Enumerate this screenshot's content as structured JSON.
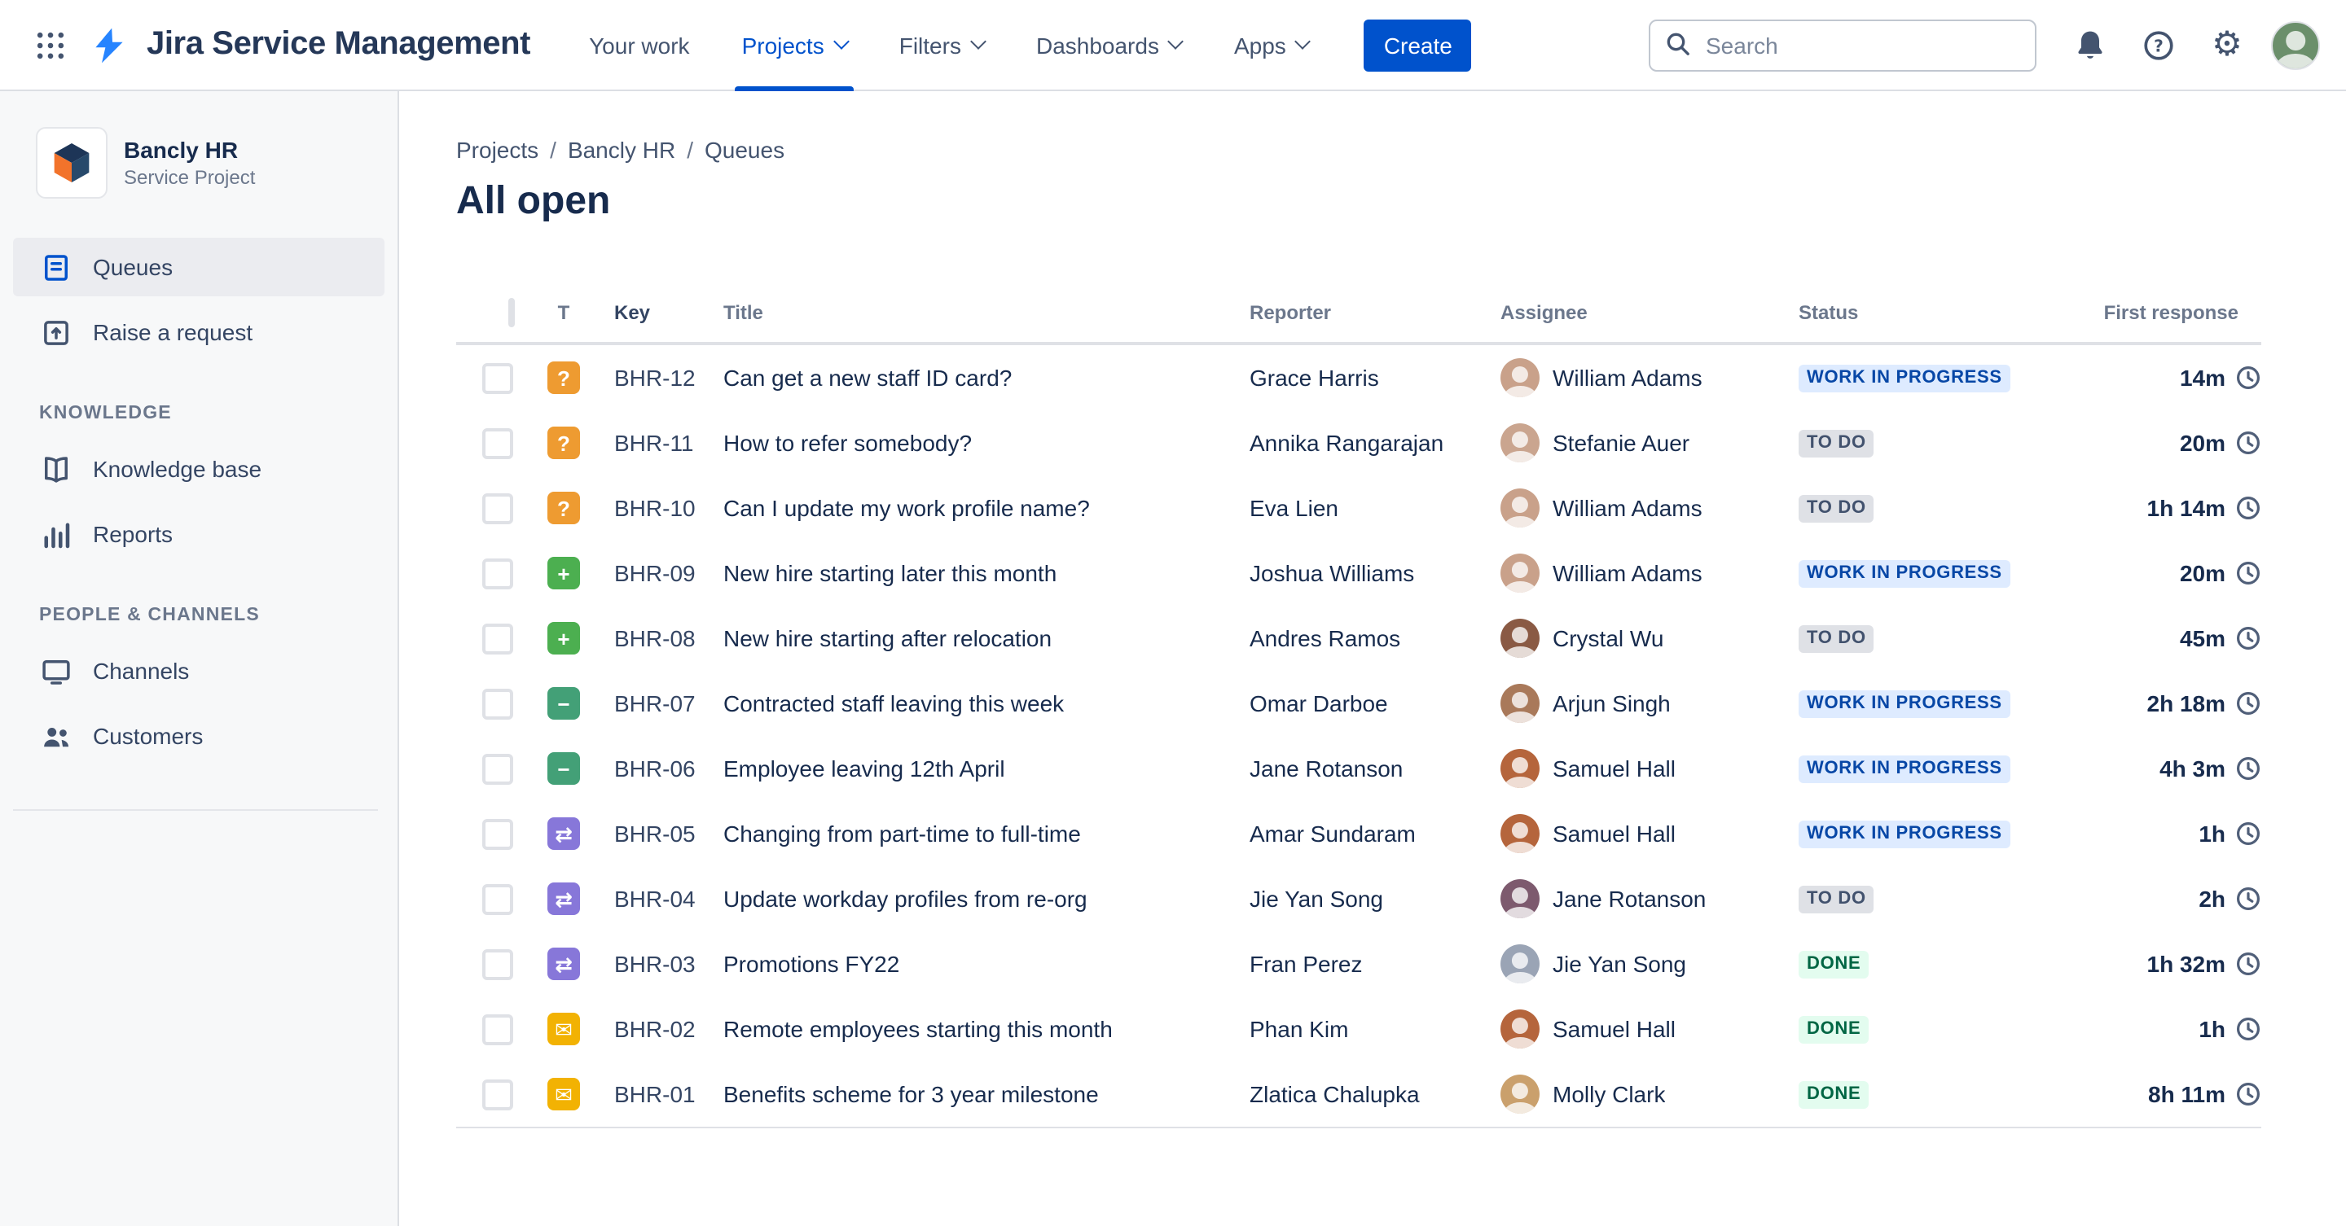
{
  "topbar": {
    "app_name": "Jira Service Management",
    "nav": [
      {
        "label": "Your work",
        "chevron": false,
        "active": false
      },
      {
        "label": "Projects",
        "chevron": true,
        "active": true
      },
      {
        "label": "Filters",
        "chevron": true,
        "active": false
      },
      {
        "label": "Dashboards",
        "chevron": true,
        "active": false
      },
      {
        "label": "Apps",
        "chevron": true,
        "active": false
      }
    ],
    "create_button": "Create",
    "search_placeholder": "Search",
    "icon_names": [
      "app-switcher-icon",
      "jira-logo",
      "notifications-icon",
      "help-icon",
      "settings-icon",
      "user-avatar"
    ],
    "accent_color": "#0052CC"
  },
  "sidebar": {
    "project_name": "Bancly HR",
    "project_subtitle": "Service Project",
    "main_items": [
      {
        "label": "Queues",
        "icon": "queues-icon",
        "active": true
      },
      {
        "label": "Raise a request",
        "icon": "raise-request-icon",
        "active": false
      }
    ],
    "sections": [
      {
        "heading": "KNOWLEDGE",
        "items": [
          {
            "label": "Knowledge base",
            "icon": "knowledge-base-icon"
          },
          {
            "label": "Reports",
            "icon": "reports-icon"
          }
        ]
      },
      {
        "heading": "PEOPLE & CHANNELS",
        "items": [
          {
            "label": "Channels",
            "icon": "channels-icon"
          },
          {
            "label": "Customers",
            "icon": "customers-icon"
          }
        ]
      }
    ]
  },
  "breadcrumb": {
    "items": [
      "Projects",
      "Bancly HR",
      "Queues"
    ],
    "separator": "/"
  },
  "page_title": "All open",
  "queue_table": {
    "columns": {
      "type": "T",
      "key": "Key",
      "title": "Title",
      "reporter": "Reporter",
      "assignee": "Assignee",
      "status": "Status",
      "first_response": "First response"
    },
    "status_colors": {
      "WORK IN PROGRESS": {
        "bg": "#DEEBFF",
        "text": "#0747A6"
      },
      "TO DO": {
        "bg": "#DFE1E6",
        "text": "#42526E"
      },
      "DONE": {
        "bg": "#E3FCEF",
        "text": "#006644"
      }
    },
    "type_icons": {
      "question": {
        "glyph": "?",
        "color": "#EE9B31"
      },
      "new-starter": {
        "glyph": "+",
        "color": "#4CAF50"
      },
      "leaver": {
        "glyph": "−",
        "color": "#43A077"
      },
      "change": {
        "glyph": "⇄",
        "color": "#8777D9"
      },
      "email": {
        "glyph": "✉",
        "color": "#F2B203"
      }
    },
    "rows": [
      {
        "type": "question",
        "key": "BHR-12",
        "title": "Can get a new staff ID card?",
        "reporter": "Grace Harris",
        "assignee": "William Adams",
        "status": "WORK IN PROGRESS",
        "first_response": "14m",
        "avatar_color": "#c9a18a"
      },
      {
        "type": "question",
        "key": "BHR-11",
        "title": "How to refer somebody?",
        "reporter": "Annika Rangarajan",
        "assignee": "Stefanie Auer",
        "status": "TO DO",
        "first_response": "20m",
        "avatar_color": "#caa58f"
      },
      {
        "type": "question",
        "key": "BHR-10",
        "title": "Can I update my work profile name?",
        "reporter": "Eva Lien",
        "assignee": "William Adams",
        "status": "TO DO",
        "first_response": "1h 14m",
        "avatar_color": "#c9a18a"
      },
      {
        "type": "new-starter",
        "key": "BHR-09",
        "title": "New hire starting later this month",
        "reporter": "Joshua Williams",
        "assignee": "William Adams",
        "status": "WORK IN PROGRESS",
        "first_response": "20m",
        "avatar_color": "#c9a18a"
      },
      {
        "type": "new-starter",
        "key": "BHR-08",
        "title": "New hire starting after relocation",
        "reporter": "Andres Ramos",
        "assignee": "Crystal Wu",
        "status": "TO DO",
        "first_response": "45m",
        "avatar_color": "#8a5a44"
      },
      {
        "type": "leaver",
        "key": "BHR-07",
        "title": "Contracted staff leaving this week",
        "reporter": "Omar Darboe",
        "assignee": "Arjun Singh",
        "status": "WORK IN PROGRESS",
        "first_response": "2h 18m",
        "avatar_color": "#a9795a"
      },
      {
        "type": "leaver",
        "key": "BHR-06",
        "title": "Employee leaving 12th April",
        "reporter": "Jane Rotanson",
        "assignee": "Samuel Hall",
        "status": "WORK IN PROGRESS",
        "first_response": "4h 3m",
        "avatar_color": "#b5653c"
      },
      {
        "type": "change",
        "key": "BHR-05",
        "title": "Changing from part-time to full-time",
        "reporter": "Amar Sundaram",
        "assignee": "Samuel Hall",
        "status": "WORK IN PROGRESS",
        "first_response": "1h",
        "avatar_color": "#b5653c"
      },
      {
        "type": "change",
        "key": "BHR-04",
        "title": "Update workday profiles from re-org",
        "reporter": "Jie Yan Song",
        "assignee": "Jane Rotanson",
        "status": "TO DO",
        "first_response": "2h",
        "avatar_color": "#7d5a6e"
      },
      {
        "type": "change",
        "key": "BHR-03",
        "title": "Promotions FY22",
        "reporter": "Fran Perez",
        "assignee": "Jie Yan Song",
        "status": "DONE",
        "first_response": "1h 32m",
        "avatar_color": "#9aa4b5"
      },
      {
        "type": "email",
        "key": "BHR-02",
        "title": "Remote employees starting this month",
        "reporter": "Phan Kim",
        "assignee": "Samuel Hall",
        "status": "DONE",
        "first_response": "1h",
        "avatar_color": "#b5653c"
      },
      {
        "type": "email",
        "key": "BHR-01",
        "title": "Benefits scheme for 3 year milestone",
        "reporter": "Zlatica Chalupka",
        "assignee": "Molly Clark",
        "status": "DONE",
        "first_response": "8h 11m",
        "avatar_color": "#caa06c"
      }
    ]
  }
}
